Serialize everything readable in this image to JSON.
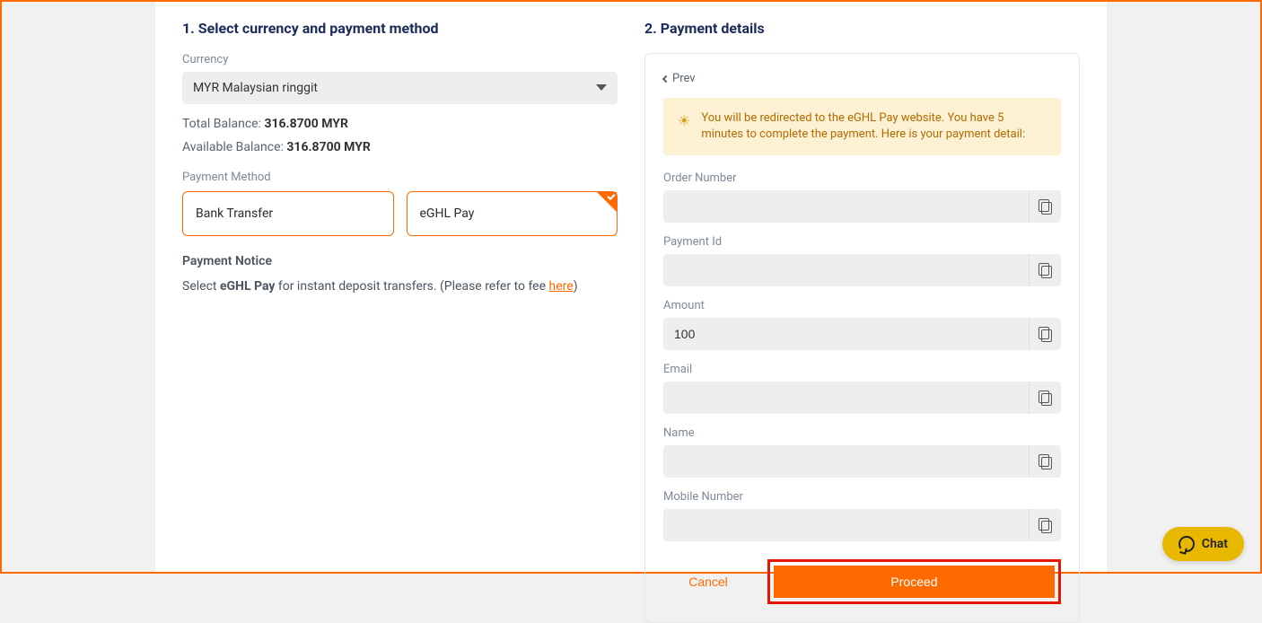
{
  "left": {
    "title": "1. Select currency and payment method",
    "currency_label": "Currency",
    "currency_value": "MYR Malaysian ringgit",
    "total_balance_label": "Total Balance:",
    "total_balance_value": "316.8700 MYR",
    "available_balance_label": "Available Balance:",
    "available_balance_value": "316.8700 MYR",
    "payment_method_label": "Payment Method",
    "pm_options": {
      "bank_transfer": "Bank Transfer",
      "eghl": "eGHL Pay"
    },
    "notice_title": "Payment Notice",
    "notice_prefix": "Select ",
    "notice_bold": "eGHL Pay",
    "notice_mid": " for instant deposit transfers. (Please refer to fee ",
    "notice_link": "here",
    "notice_suffix": ")"
  },
  "right": {
    "title": "2. Payment details",
    "prev": "Prev",
    "warn": "You will be redirected to the eGHL Pay website. You have 5 minutes to complete the payment. Here is your payment detail:",
    "fields": {
      "order_number": {
        "label": "Order Number",
        "value": ""
      },
      "payment_id": {
        "label": "Payment Id",
        "value": ""
      },
      "amount": {
        "label": "Amount",
        "value": "100"
      },
      "email": {
        "label": "Email",
        "value": ""
      },
      "name": {
        "label": "Name",
        "value": ""
      },
      "mobile": {
        "label": "Mobile Number",
        "value": ""
      }
    },
    "cancel": "Cancel",
    "proceed": "Proceed"
  },
  "chat": {
    "label": "Chat"
  }
}
